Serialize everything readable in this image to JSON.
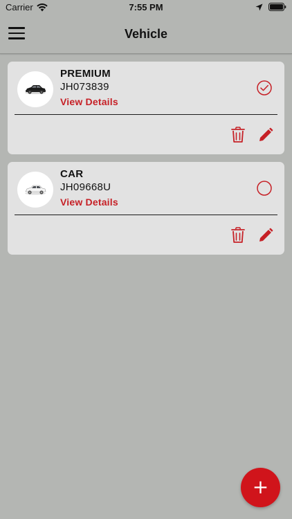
{
  "status_bar": {
    "carrier": "Carrier",
    "time": "7:55 PM"
  },
  "header": {
    "title": "Vehicle",
    "menu_icon": "hamburger-menu-icon"
  },
  "vehicles": [
    {
      "type": "PREMIUM",
      "plate": "JH073839",
      "view_details_label": "View Details",
      "selected": true,
      "image_icon": "black-sedan-icon"
    },
    {
      "type": "CAR",
      "plate": "JH09668U",
      "view_details_label": "View Details",
      "selected": false,
      "image_icon": "white-sedan-icon"
    }
  ],
  "actions": {
    "delete_icon": "trash-icon",
    "edit_icon": "pencil-icon"
  },
  "fab": {
    "label": "+"
  },
  "colors": {
    "background": "#b4b6b3",
    "card": "#e2e2e2",
    "accent": "#c62026",
    "fab": "#d0141b"
  }
}
